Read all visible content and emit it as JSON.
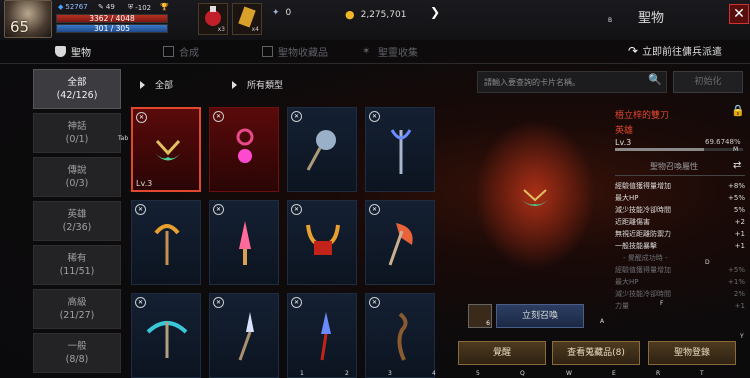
{
  "player": {
    "level": "65",
    "stat_a": "52767",
    "stat_b": "49",
    "stat_c": "-102",
    "hp": "3362 / 4048",
    "mp": "301 / 305",
    "hp_ratio": 0.83,
    "mp_ratio": 0.99
  },
  "items": {
    "slot1_count": "x3",
    "slot2_count": "x4"
  },
  "resources": {
    "gems": "0",
    "gold": "2,275,701"
  },
  "window": {
    "title": "聖物",
    "corner_key": "B"
  },
  "tabs": [
    {
      "label": "聖物"
    },
    {
      "label": "合成"
    },
    {
      "label": "聖物收藏品"
    },
    {
      "label": "聖靈收集"
    }
  ],
  "goto_label": "立即前往傭兵派遣",
  "categories": [
    {
      "name": "全部",
      "count": "(42/126)"
    },
    {
      "name": "神話",
      "count": "(0/1)"
    },
    {
      "name": "傳說",
      "count": "(0/3)"
    },
    {
      "name": "英雄",
      "count": "(2/36)"
    },
    {
      "name": "稀有",
      "count": "(11/51)"
    },
    {
      "name": "高級",
      "count": "(21/27)"
    },
    {
      "name": "一般",
      "count": "(8/8)"
    }
  ],
  "filters": {
    "grade": "全部",
    "type": "所有類型"
  },
  "tab_key": "Tab",
  "search": {
    "placeholder": "請輸入要查詢的卡片名稱。",
    "reset_label": "初始化"
  },
  "cards": [
    {
      "level": "Lv.3"
    }
  ],
  "detail": {
    "name": "梧立梓的雙刀",
    "subtitle": "英雄",
    "level": "Lv.3",
    "percent": "69.6748%",
    "progress": 0.696,
    "key": "M"
  },
  "attr_header": "聖物召喚屬性",
  "attributes": [
    {
      "name": "經驗值獲得量增加",
      "value": "+8%"
    },
    {
      "name": "最大HP",
      "value": "+5%"
    },
    {
      "name": "減少技能冷卻時間",
      "value": "5%"
    },
    {
      "name": "近距離傷害",
      "value": "+2"
    },
    {
      "name": "無視近距離防禦力",
      "value": "+1"
    },
    {
      "name": "一般技能暴擊",
      "value": "+1"
    }
  ],
  "awaken_label": "- 覺醒成功時 -",
  "awaken_attrs": [
    {
      "name": "經驗值獲得量增加",
      "value": "+5%"
    },
    {
      "name": "最大HP",
      "value": "+1%"
    },
    {
      "name": "減少技能冷卻時間",
      "value": "2%"
    },
    {
      "name": "力量",
      "value": "+1"
    }
  ],
  "summon": {
    "count": "6",
    "label": "立刻召喚"
  },
  "buttons": {
    "awaken": "覺醒",
    "collection": "查看蒐藏品(8)",
    "register": "聖物登錄"
  },
  "hotkeys": {
    "a": "A",
    "y": "Y",
    "d": "D",
    "f": "F",
    "k1": "1",
    "k2": "2",
    "k3": "3",
    "k4": "4",
    "k5": "5",
    "q": "Q",
    "w": "W",
    "e": "E",
    "r": "R",
    "t": "T"
  },
  "colors": {
    "accent": "#e2482e",
    "gold": "#f0b528",
    "hp": "#b73022",
    "mp": "#3a78c9"
  }
}
